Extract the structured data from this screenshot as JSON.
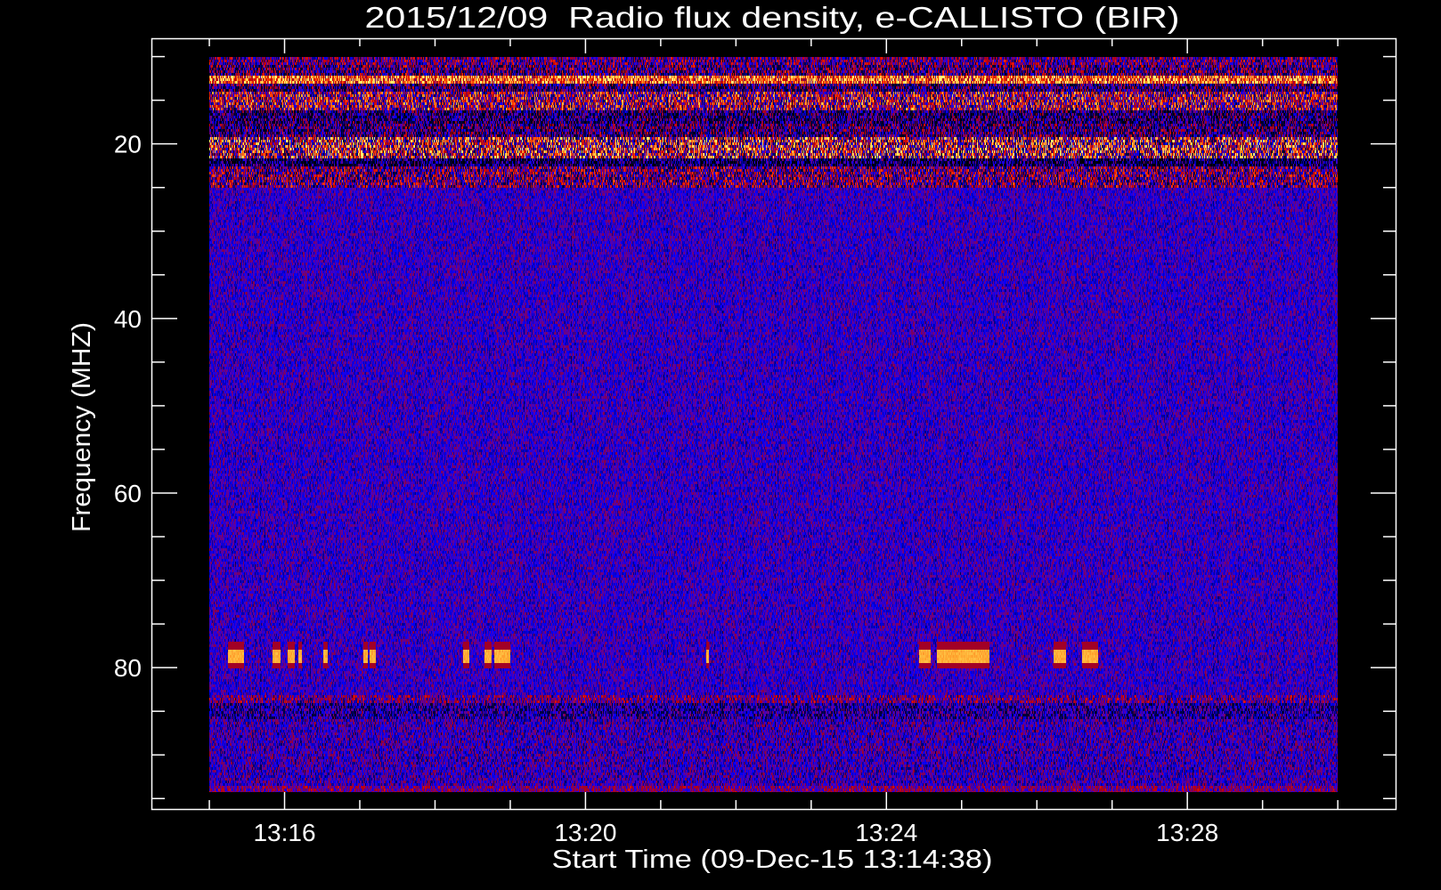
{
  "chart_data": {
    "type": "heatmap",
    "title": "2015/12/09  Radio flux density, e-CALLISTO (BIR)",
    "xlabel": "Start Time (09-Dec-15 13:14:38)",
    "ylabel": "Frequency (MHZ)",
    "x_unit": "minutes after 13:15",
    "xlim": [
      -0.77,
      15.78
    ],
    "ylim": [
      96.3,
      7.9
    ],
    "data_extent": {
      "x": [
        0,
        15
      ],
      "y": [
        10,
        94.3
      ]
    },
    "x_ticks_major": [
      {
        "value": 1,
        "label": "13:16"
      },
      {
        "value": 5,
        "label": "13:20"
      },
      {
        "value": 9,
        "label": "13:24"
      },
      {
        "value": 13,
        "label": "13:28"
      }
    ],
    "x_ticks_minor_step": 1,
    "y_ticks_major": [
      {
        "value": 20,
        "label": "20"
      },
      {
        "value": 40,
        "label": "40"
      },
      {
        "value": 60,
        "label": "60"
      },
      {
        "value": 80,
        "label": "80"
      }
    ],
    "y_ticks_minor_step": 5,
    "grid": false,
    "colormap": [
      "#000000",
      "#000050",
      "#0000ff",
      "#5a00aa",
      "#8c003c",
      "#c80000",
      "#ff3c00",
      "#ffaa32",
      "#ffff78"
    ],
    "bands": [
      {
        "from_mhz": 10,
        "to_mhz": 25,
        "level": "high, bursty interference"
      },
      {
        "from_mhz": 25,
        "to_mhz": 83,
        "level": "background"
      },
      {
        "from_mhz": 83,
        "to_mhz": 94.3,
        "level": "mixed background"
      }
    ],
    "bursts_78mhz": [
      [
        0.24,
        0.45
      ],
      [
        0.83,
        0.94
      ],
      [
        1.03,
        1.13
      ],
      [
        1.18,
        1.22
      ],
      [
        1.51,
        1.57
      ],
      [
        2.04,
        2.1
      ],
      [
        2.12,
        2.21
      ],
      [
        3.37,
        3.45
      ],
      [
        3.65,
        3.75
      ],
      [
        3.78,
        3.99
      ],
      [
        6.6,
        6.64
      ],
      [
        9.43,
        9.58
      ],
      [
        9.67,
        10.37
      ],
      [
        11.22,
        11.38
      ],
      [
        11.6,
        11.81
      ]
    ],
    "burst_frequency_mhz": [
      77.9,
      79.3
    ]
  }
}
